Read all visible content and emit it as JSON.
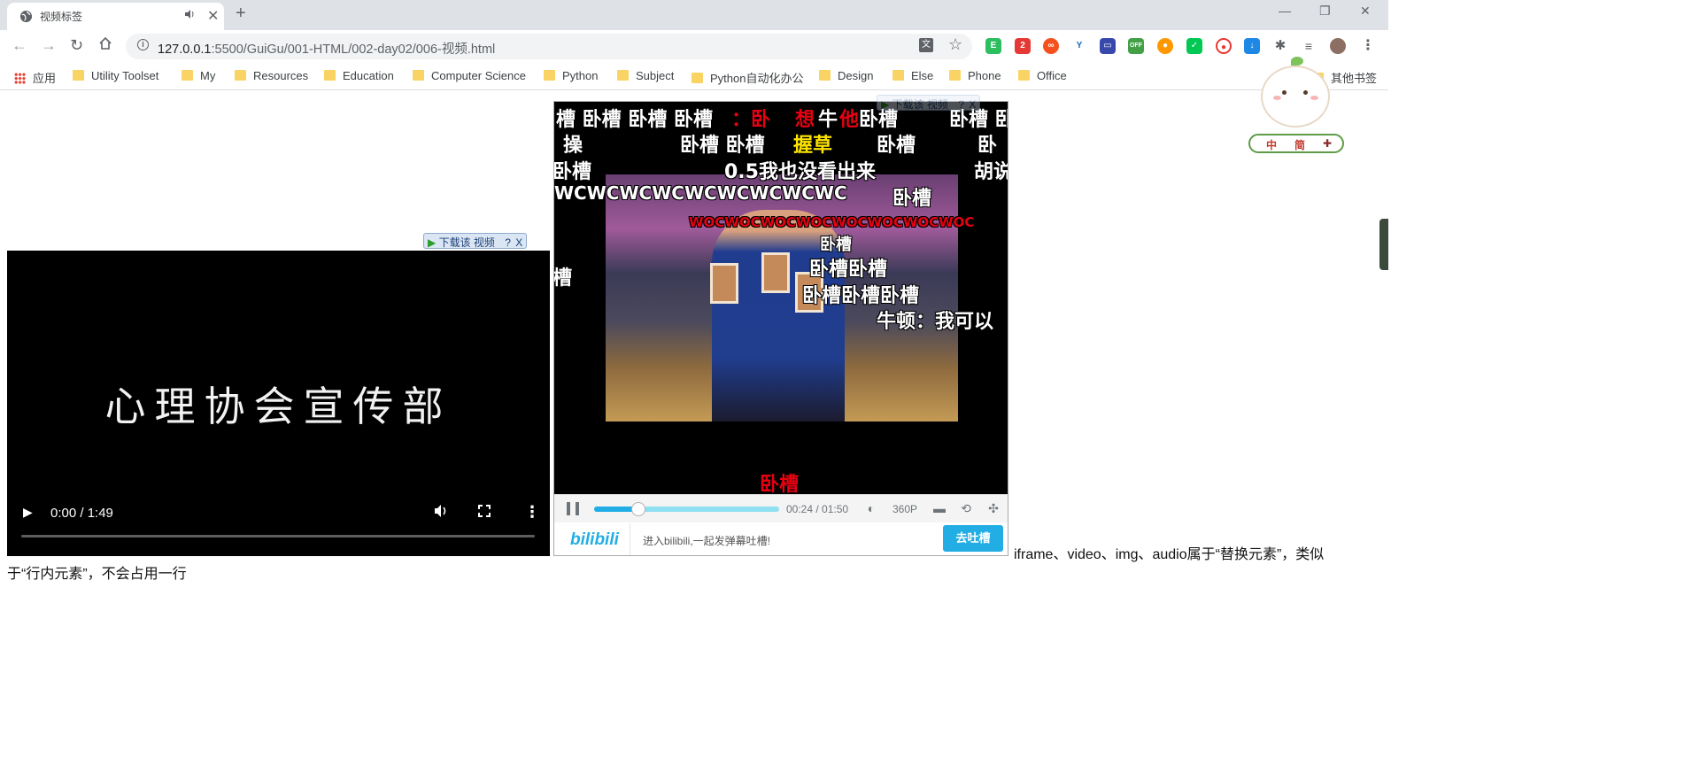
{
  "tab": {
    "title": "视频标签",
    "audio_icon": "speaker-icon",
    "close": "✕"
  },
  "window": {
    "new_tab": "+",
    "minimize": "—",
    "restore": "❐",
    "close": "✕"
  },
  "toolbar": {
    "url_host": "127.0.0.1",
    "url_path": ":5500/GuiGu/001-HTML/002-day02/006-视频.html",
    "extension_badge": "2",
    "extension_off": "OFF"
  },
  "bookmarks": {
    "apps": "应用",
    "items": [
      "Utility Toolset",
      "My",
      "Resources",
      "Education",
      "Computer Science",
      "Python",
      "Subject",
      "Python自动化办公",
      "Design",
      "Else",
      "Phone",
      "Office"
    ],
    "other": "其他书签"
  },
  "download_badge": {
    "label": "下载该 视频",
    "help": "?",
    "close": "X"
  },
  "video": {
    "poster_text": "心理协会宣传部",
    "time": "0:00 / 1:49"
  },
  "bilibili": {
    "danmaku": [
      {
        "text": "槽 卧槽  卧槽 卧槽",
        "color": "white"
      },
      {
        "text": "：卧",
        "color": "red"
      },
      {
        "text": "想",
        "color": "red"
      },
      {
        "text": "牛",
        "color": "white"
      },
      {
        "text": "他",
        "color": "red"
      },
      {
        "text": "卧槽",
        "color": "white"
      },
      {
        "text": "卧槽 卧",
        "color": "white"
      },
      {
        "text": "操",
        "color": "white"
      },
      {
        "text": "卧槽 卧槽",
        "color": "white"
      },
      {
        "text": "握草",
        "color": "yellow"
      },
      {
        "text": "卧槽",
        "color": "white"
      },
      {
        "text": "卧",
        "color": "white"
      },
      {
        "text": "卧槽",
        "color": "white"
      },
      {
        "text": "0.5我也没看出来",
        "color": "white"
      },
      {
        "text": "胡说",
        "color": "white"
      },
      {
        "text": "WCWCWCWCWCWCWCWCWC",
        "color": "white"
      },
      {
        "text": "卧槽",
        "color": "white"
      },
      {
        "text": "WOCWOCWOCWOCWOCWOCWOCWOC",
        "color": "red"
      },
      {
        "text": "卧槽",
        "color": "white"
      },
      {
        "text": "卧槽卧槽",
        "color": "white"
      },
      {
        "text": "槽",
        "color": "white"
      },
      {
        "text": "卧槽卧槽卧槽",
        "color": "white"
      },
      {
        "text": "牛顿：我可以",
        "color": "white"
      },
      {
        "text": "卧槽",
        "color": "red"
      }
    ],
    "time": "00:24 / 01:50",
    "quality": "360P",
    "progress": 0.24,
    "logo": "bilibili",
    "hint": "进入bilibili,一起发弹幕吐槽!",
    "send": "去吐槽"
  },
  "paragraph": {
    "line1": "iframe、video、img、audio属于“替换元素”，类似",
    "line2": "于“行内元素”，不会占用一行"
  },
  "mascot": {
    "labels": [
      "中",
      "简",
      "✚"
    ]
  },
  "colors": {
    "bilibili_blue": "#23ade5",
    "danmaku_red": "#e60012",
    "danmaku_yellow": "#ffe400"
  }
}
